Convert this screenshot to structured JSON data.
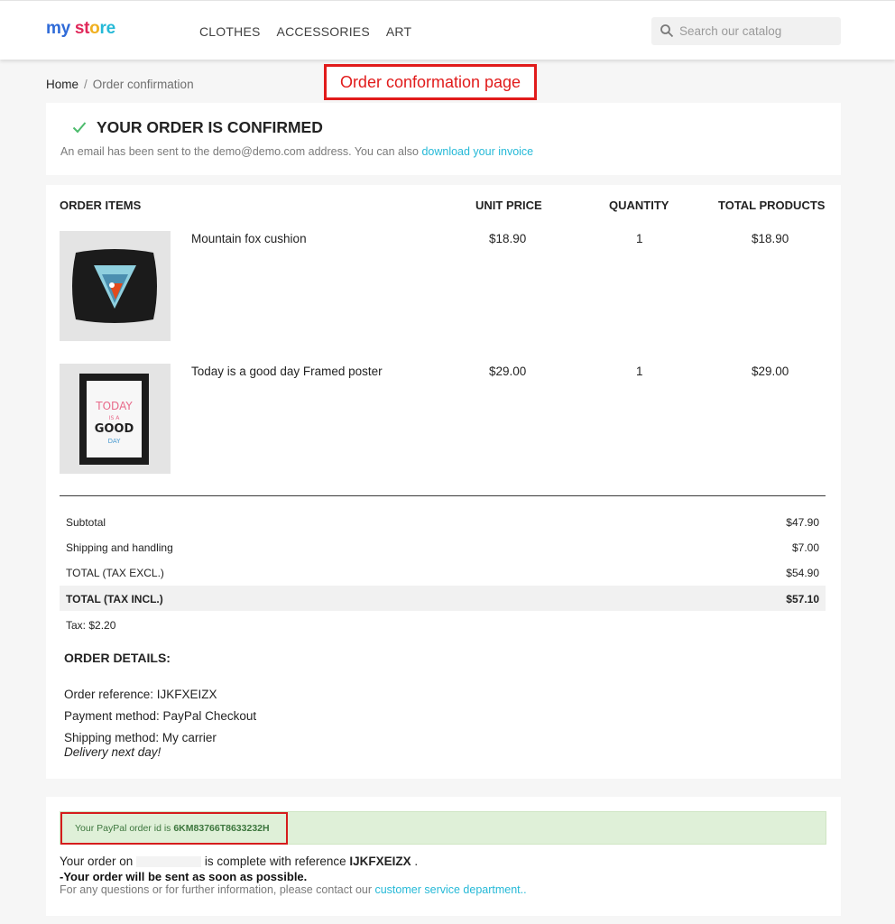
{
  "header": {
    "logo": [
      "my",
      " st",
      "o",
      "re"
    ],
    "nav": [
      "CLOTHES",
      "ACCESSORIES",
      "ART"
    ],
    "search_placeholder": "Search our catalog"
  },
  "breadcrumb": {
    "home": "Home",
    "separator": "/",
    "current": "Order confirmation"
  },
  "annotation": "Order conformation page",
  "confirmation": {
    "title": "YOUR ORDER IS CONFIRMED",
    "text": "An email has been sent to the demo@demo.com address. You can also ",
    "invoice_link": "download your invoice"
  },
  "items": {
    "headers": [
      "ORDER ITEMS",
      "UNIT PRICE",
      "QUANTITY",
      "TOTAL PRODUCTS"
    ],
    "rows": [
      {
        "name": "Mountain fox cushion",
        "unit_price": "$18.90",
        "quantity": "1",
        "total": "$18.90",
        "image": "fox-cushion"
      },
      {
        "name": "Today is a good day Framed poster",
        "unit_price": "$29.00",
        "quantity": "1",
        "total": "$29.00",
        "image": "framed-poster"
      }
    ]
  },
  "poster_art": {
    "line1": "TODAY",
    "line2": "IS A",
    "line3": "GOOD",
    "line4": "DAY"
  },
  "summary": {
    "subtotal_label": "Subtotal",
    "subtotal": "$47.90",
    "shipping_label": "Shipping and handling",
    "shipping": "$7.00",
    "excl_label": "TOTAL (TAX EXCL.)",
    "excl": "$54.90",
    "incl_label": "TOTAL (TAX INCL.)",
    "incl": "$57.10",
    "tax": "Tax: $2.20"
  },
  "order_details": {
    "title": "ORDER DETAILS:",
    "reference": "Order reference: IJKFXEIZX",
    "payment": "Payment method: PayPal Checkout",
    "shipping": "Shipping method: My carrier",
    "delivery": "Delivery next day!"
  },
  "paypal": {
    "prefix": "Your PayPal order id is ",
    "order_id": "6KM83766T8633232H",
    "line1_a": "Your order on ",
    "line1_b": " is complete with reference ",
    "reference": "IJKFXEIZX",
    "line1_c": " .",
    "line2": "-Your order will be sent as soon as possible.",
    "line3": "For any questions or for further information, please contact our ",
    "service_link": "customer service department.."
  },
  "colors": {
    "accent": "#25b9d7",
    "success_bg": "#dff0d8",
    "annotation": "#e11b1b"
  }
}
